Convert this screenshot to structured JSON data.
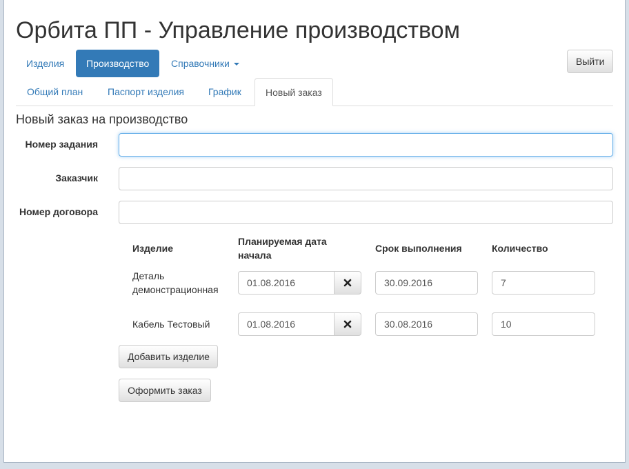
{
  "app": {
    "title": "Орбита ПП - Управление производством"
  },
  "nav": {
    "items": [
      {
        "label": "Изделия"
      },
      {
        "label": "Производство"
      },
      {
        "label": "Справочники"
      }
    ],
    "active_index": 1,
    "logout_label": "Выйти"
  },
  "tabs": {
    "items": [
      {
        "label": "Общий план"
      },
      {
        "label": "Паспорт изделия"
      },
      {
        "label": "График"
      },
      {
        "label": "Новый заказ"
      }
    ],
    "active_index": 3
  },
  "form": {
    "section_title": "Новый заказ на производство",
    "task_number": {
      "label": "Номер задания",
      "value": ""
    },
    "customer": {
      "label": "Заказчик",
      "value": ""
    },
    "contract_number": {
      "label": "Номер договора",
      "value": ""
    }
  },
  "products_table": {
    "headers": {
      "product": "Изделие",
      "planned_start": "Планируемая дата начала",
      "deadline": "Срок выполнения",
      "quantity": "Количество"
    },
    "rows": [
      {
        "product": "Деталь демонстрационная",
        "planned_start": "01.08.2016",
        "deadline": "30.09.2016",
        "quantity": "7"
      },
      {
        "product": "Кабель Тестовый",
        "planned_start": "01.08.2016",
        "deadline": "30.08.2016",
        "quantity": "10"
      }
    ]
  },
  "actions": {
    "add_product_label": "Добавить изделие",
    "submit_label": "Оформить заказ"
  },
  "icons": {
    "clear_date": "close-x-icon",
    "dropdown": "caret-down-icon"
  },
  "colors": {
    "accent": "#337ab7",
    "focus_border": "#66afe9"
  }
}
